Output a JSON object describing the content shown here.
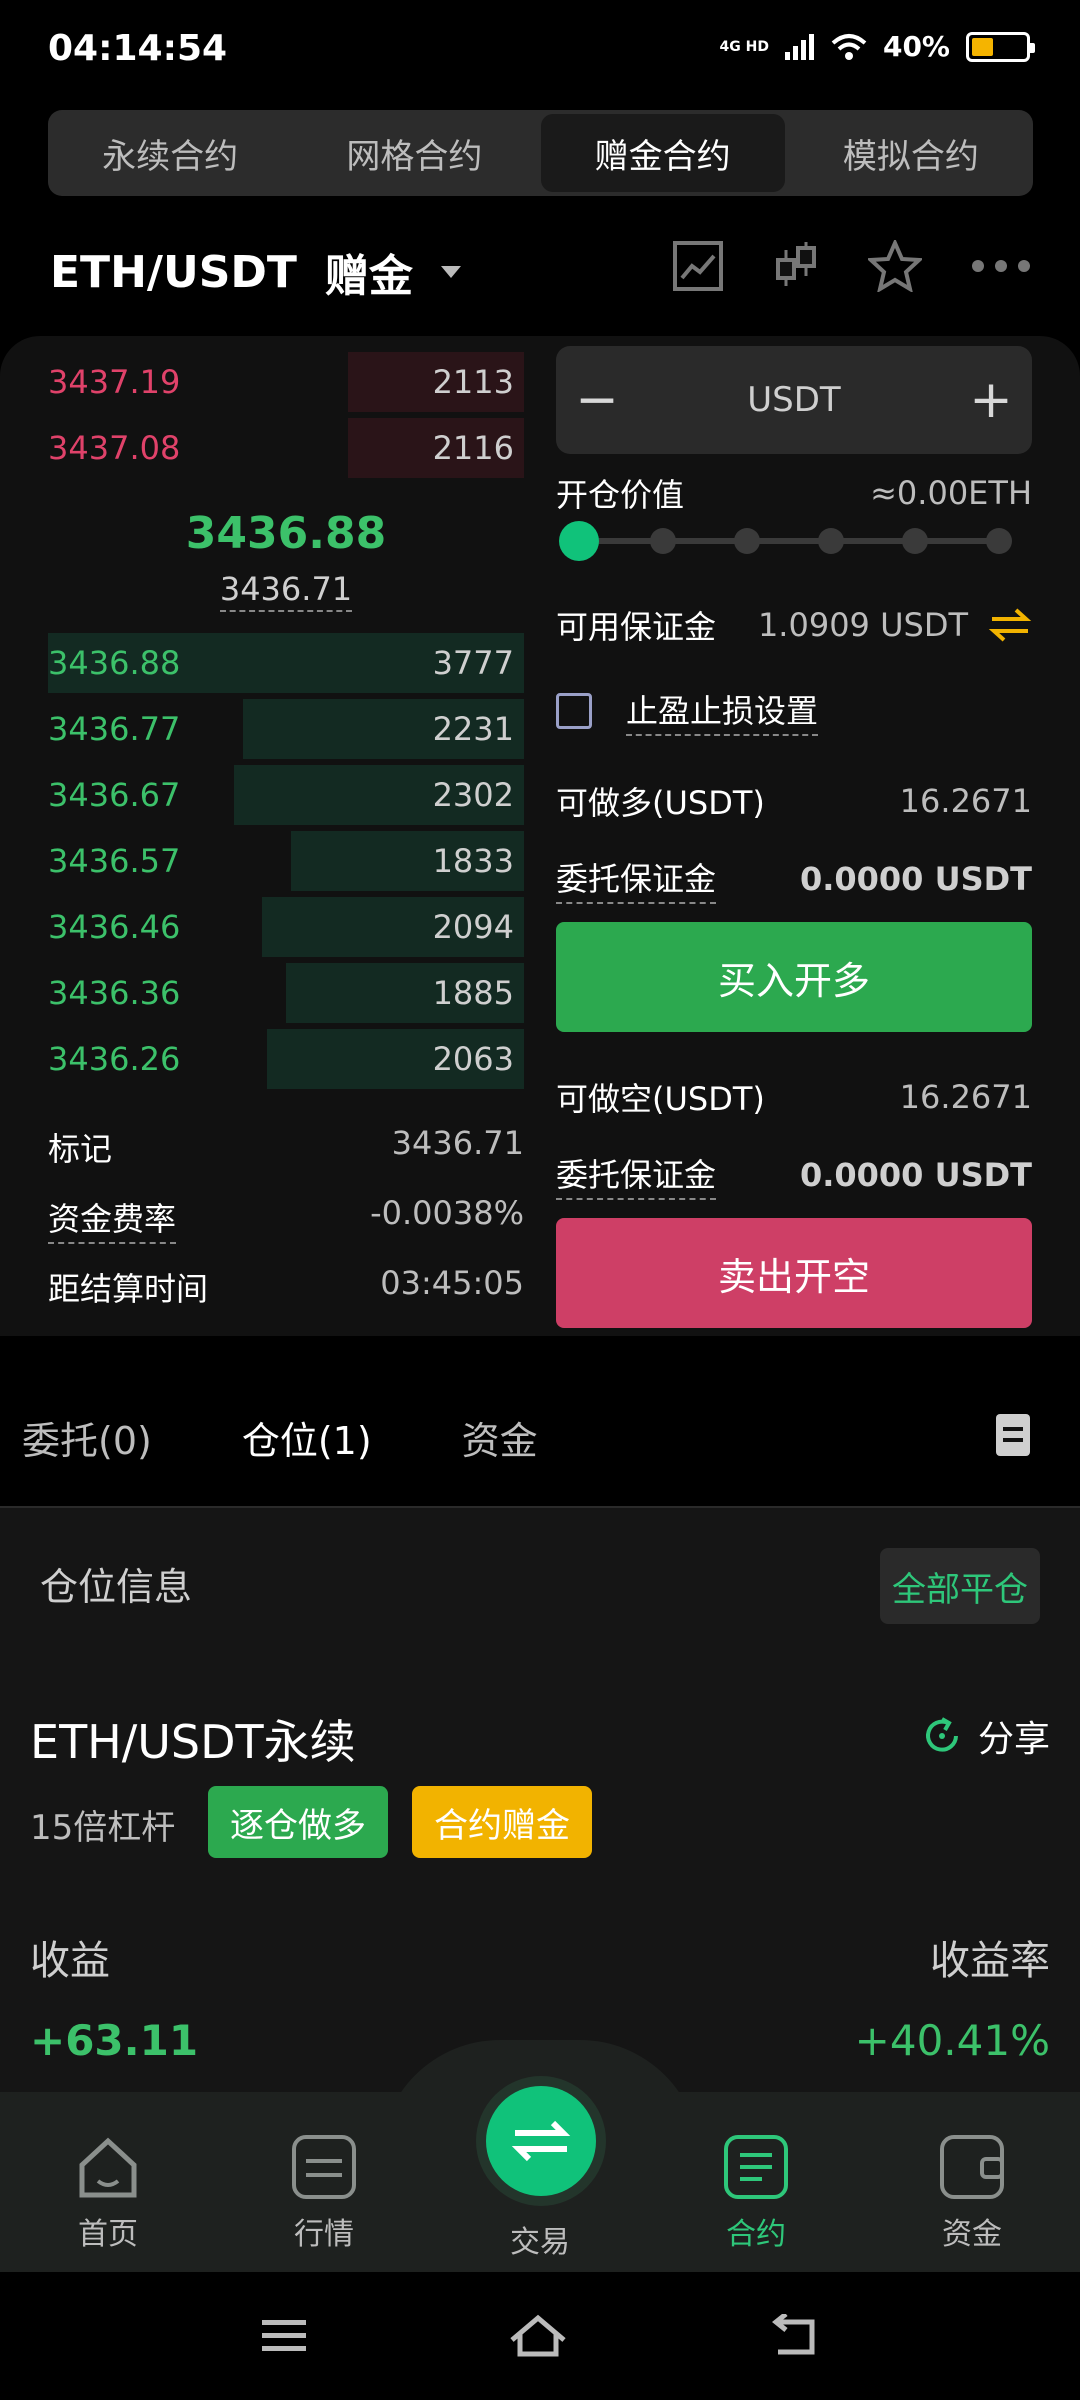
{
  "status": {
    "time": "04:14:54",
    "network": "4G HD",
    "battery": "40%",
    "battery_level": 0.4
  },
  "top_tabs": [
    {
      "label": "永续合约",
      "active": false
    },
    {
      "label": "网格合约",
      "active": false
    },
    {
      "label": "赠金合约",
      "active": true
    },
    {
      "label": "模拟合约",
      "active": false
    }
  ],
  "pair": {
    "symbol": "ETH/USDT",
    "mode": "赠金"
  },
  "header_icons": [
    "chart-line-icon",
    "candlestick-icon",
    "star-icon",
    "more-icon"
  ],
  "orderbook": {
    "asks": [
      {
        "price": "3437.19",
        "qty": "2113",
        "depth": 0.37
      },
      {
        "price": "3437.08",
        "qty": "2116",
        "depth": 0.37
      }
    ],
    "last_price": "3436.88",
    "mark_price": "3436.71",
    "bids": [
      {
        "price": "3436.88",
        "qty": "3777",
        "depth": 1.0
      },
      {
        "price": "3436.77",
        "qty": "2231",
        "depth": 0.59
      },
      {
        "price": "3436.67",
        "qty": "2302",
        "depth": 0.61
      },
      {
        "price": "3436.57",
        "qty": "1833",
        "depth": 0.49
      },
      {
        "price": "3436.46",
        "qty": "2094",
        "depth": 0.55
      },
      {
        "price": "3436.36",
        "qty": "1885",
        "depth": 0.5
      },
      {
        "price": "3436.26",
        "qty": "2063",
        "depth": 0.54
      }
    ]
  },
  "market_info": {
    "mark_label": "标记",
    "mark_value": "3436.71",
    "funding_label": "资金费率",
    "funding_value": "-0.0038%",
    "settle_label": "距结算时间",
    "settle_value": "03:45:05"
  },
  "order_form": {
    "amount_unit": "USDT",
    "minus": "−",
    "plus": "+",
    "open_value_label": "开仓价值",
    "open_value": "≈0.00ETH",
    "slider_steps": 6,
    "slider_position": 0,
    "available_label": "可用保证金",
    "available_value": "1.0909 USDT",
    "tpsl_label": "止盈止损设置",
    "long_max_label": "可做多(USDT)",
    "long_max_value": "16.2671",
    "long_margin_label": "委托保证金",
    "long_margin_value": "0.0000 USDT",
    "buy_label": "买入开多",
    "short_max_label": "可做空(USDT)",
    "short_max_value": "16.2671",
    "short_margin_label": "委托保证金",
    "short_margin_value": "0.0000 USDT",
    "sell_label": "卖出开空"
  },
  "position_tabs": [
    {
      "label": "委托(0)",
      "active": false
    },
    {
      "label": "仓位(1)",
      "active": true
    },
    {
      "label": "资金",
      "active": false
    }
  ],
  "position": {
    "section_title": "仓位信息",
    "close_all": "全部平仓",
    "pair": "ETH/USDT永续",
    "share": "分享",
    "leverage": "15倍杠杆",
    "tag_mode": "逐仓做多",
    "tag_bonus": "合约赠金",
    "pnl_label": "收益",
    "pnl_value": "+63.11",
    "roe_label": "收益率",
    "roe_value": "+40.41%"
  },
  "bottom_nav": [
    {
      "label": "首页",
      "icon": "home-icon",
      "active": false
    },
    {
      "label": "行情",
      "icon": "market-icon",
      "active": false
    },
    {
      "label": "交易",
      "icon": "swap-icon",
      "active": false
    },
    {
      "label": "合约",
      "icon": "contract-icon",
      "active": true
    },
    {
      "label": "资金",
      "icon": "wallet-icon",
      "active": false
    }
  ],
  "colors": {
    "green": "#3cc16a",
    "red": "#e0426a",
    "accent": "#10c27a",
    "yellow": "#f2b300"
  }
}
